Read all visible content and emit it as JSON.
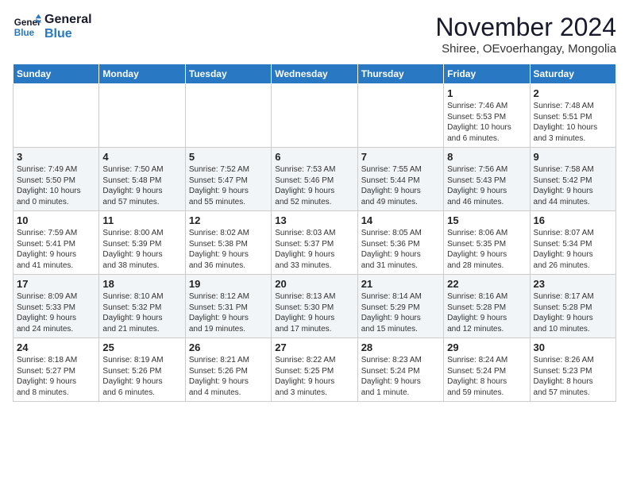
{
  "logo": {
    "line1": "General",
    "line2": "Blue"
  },
  "title": "November 2024",
  "subtitle": "Shiree, OEvoerhangay, Mongolia",
  "days_of_week": [
    "Sunday",
    "Monday",
    "Tuesday",
    "Wednesday",
    "Thursday",
    "Friday",
    "Saturday"
  ],
  "weeks": [
    [
      {
        "day": "",
        "info": ""
      },
      {
        "day": "",
        "info": ""
      },
      {
        "day": "",
        "info": ""
      },
      {
        "day": "",
        "info": ""
      },
      {
        "day": "",
        "info": ""
      },
      {
        "day": "1",
        "info": "Sunrise: 7:46 AM\nSunset: 5:53 PM\nDaylight: 10 hours\nand 6 minutes."
      },
      {
        "day": "2",
        "info": "Sunrise: 7:48 AM\nSunset: 5:51 PM\nDaylight: 10 hours\nand 3 minutes."
      }
    ],
    [
      {
        "day": "3",
        "info": "Sunrise: 7:49 AM\nSunset: 5:50 PM\nDaylight: 10 hours\nand 0 minutes."
      },
      {
        "day": "4",
        "info": "Sunrise: 7:50 AM\nSunset: 5:48 PM\nDaylight: 9 hours\nand 57 minutes."
      },
      {
        "day": "5",
        "info": "Sunrise: 7:52 AM\nSunset: 5:47 PM\nDaylight: 9 hours\nand 55 minutes."
      },
      {
        "day": "6",
        "info": "Sunrise: 7:53 AM\nSunset: 5:46 PM\nDaylight: 9 hours\nand 52 minutes."
      },
      {
        "day": "7",
        "info": "Sunrise: 7:55 AM\nSunset: 5:44 PM\nDaylight: 9 hours\nand 49 minutes."
      },
      {
        "day": "8",
        "info": "Sunrise: 7:56 AM\nSunset: 5:43 PM\nDaylight: 9 hours\nand 46 minutes."
      },
      {
        "day": "9",
        "info": "Sunrise: 7:58 AM\nSunset: 5:42 PM\nDaylight: 9 hours\nand 44 minutes."
      }
    ],
    [
      {
        "day": "10",
        "info": "Sunrise: 7:59 AM\nSunset: 5:41 PM\nDaylight: 9 hours\nand 41 minutes."
      },
      {
        "day": "11",
        "info": "Sunrise: 8:00 AM\nSunset: 5:39 PM\nDaylight: 9 hours\nand 38 minutes."
      },
      {
        "day": "12",
        "info": "Sunrise: 8:02 AM\nSunset: 5:38 PM\nDaylight: 9 hours\nand 36 minutes."
      },
      {
        "day": "13",
        "info": "Sunrise: 8:03 AM\nSunset: 5:37 PM\nDaylight: 9 hours\nand 33 minutes."
      },
      {
        "day": "14",
        "info": "Sunrise: 8:05 AM\nSunset: 5:36 PM\nDaylight: 9 hours\nand 31 minutes."
      },
      {
        "day": "15",
        "info": "Sunrise: 8:06 AM\nSunset: 5:35 PM\nDaylight: 9 hours\nand 28 minutes."
      },
      {
        "day": "16",
        "info": "Sunrise: 8:07 AM\nSunset: 5:34 PM\nDaylight: 9 hours\nand 26 minutes."
      }
    ],
    [
      {
        "day": "17",
        "info": "Sunrise: 8:09 AM\nSunset: 5:33 PM\nDaylight: 9 hours\nand 24 minutes."
      },
      {
        "day": "18",
        "info": "Sunrise: 8:10 AM\nSunset: 5:32 PM\nDaylight: 9 hours\nand 21 minutes."
      },
      {
        "day": "19",
        "info": "Sunrise: 8:12 AM\nSunset: 5:31 PM\nDaylight: 9 hours\nand 19 minutes."
      },
      {
        "day": "20",
        "info": "Sunrise: 8:13 AM\nSunset: 5:30 PM\nDaylight: 9 hours\nand 17 minutes."
      },
      {
        "day": "21",
        "info": "Sunrise: 8:14 AM\nSunset: 5:29 PM\nDaylight: 9 hours\nand 15 minutes."
      },
      {
        "day": "22",
        "info": "Sunrise: 8:16 AM\nSunset: 5:28 PM\nDaylight: 9 hours\nand 12 minutes."
      },
      {
        "day": "23",
        "info": "Sunrise: 8:17 AM\nSunset: 5:28 PM\nDaylight: 9 hours\nand 10 minutes."
      }
    ],
    [
      {
        "day": "24",
        "info": "Sunrise: 8:18 AM\nSunset: 5:27 PM\nDaylight: 9 hours\nand 8 minutes."
      },
      {
        "day": "25",
        "info": "Sunrise: 8:19 AM\nSunset: 5:26 PM\nDaylight: 9 hours\nand 6 minutes."
      },
      {
        "day": "26",
        "info": "Sunrise: 8:21 AM\nSunset: 5:26 PM\nDaylight: 9 hours\nand 4 minutes."
      },
      {
        "day": "27",
        "info": "Sunrise: 8:22 AM\nSunset: 5:25 PM\nDaylight: 9 hours\nand 3 minutes."
      },
      {
        "day": "28",
        "info": "Sunrise: 8:23 AM\nSunset: 5:24 PM\nDaylight: 9 hours\nand 1 minute."
      },
      {
        "day": "29",
        "info": "Sunrise: 8:24 AM\nSunset: 5:24 PM\nDaylight: 8 hours\nand 59 minutes."
      },
      {
        "day": "30",
        "info": "Sunrise: 8:26 AM\nSunset: 5:23 PM\nDaylight: 8 hours\nand 57 minutes."
      }
    ]
  ]
}
